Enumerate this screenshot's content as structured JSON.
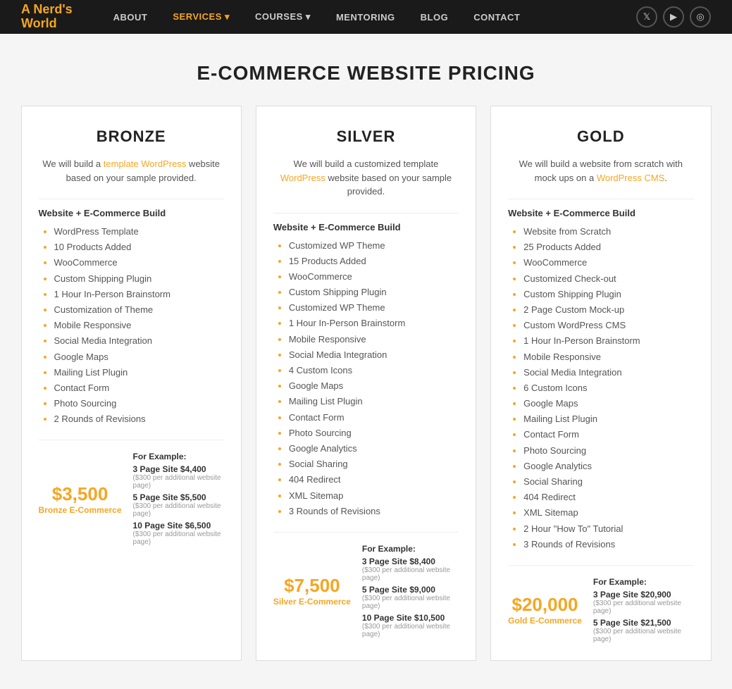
{
  "nav": {
    "logo_line1": "A Nerd's",
    "logo_line2": "World",
    "links": [
      {
        "label": "ABOUT",
        "active": false
      },
      {
        "label": "SERVICES ▾",
        "active": true
      },
      {
        "label": "COURSES ▾",
        "active": false
      },
      {
        "label": "MENTORING",
        "active": false
      },
      {
        "label": "BLOG",
        "active": false
      },
      {
        "label": "CONTACT",
        "active": false
      }
    ],
    "icons": [
      "𝕏",
      "▶",
      "📷"
    ]
  },
  "page": {
    "title": "E-COMMERCE WEBSITE PRICING"
  },
  "cards": [
    {
      "title": "BRONZE",
      "desc_parts": [
        "We will build a ",
        "template WordPress",
        " website based on your sample provided."
      ],
      "desc_link_index": 1,
      "section_label": "Website + E-Commerce Build",
      "features": [
        "WordPress Template",
        "10 Products Added",
        "WooCommerce",
        "Custom Shipping Plugin",
        "1 Hour In-Person Brainstorm",
        "Customization of Theme",
        "Mobile Responsive",
        "Social Media Integration",
        "Google Maps",
        "Mailing List Plugin",
        "Contact Form",
        "Photo Sourcing",
        "2 Rounds of Revisions"
      ],
      "price_main": "$3,500",
      "price_label": "Bronze E-Commerce",
      "for_example": "For Example:",
      "tiers": [
        {
          "label": "3 Page Site $4,400",
          "note": "($300 per additional website page)"
        },
        {
          "label": "5 Page Site $5,500",
          "note": "($300 per additional website page)"
        },
        {
          "label": "10 Page Site $6,500",
          "note": "($300 per additional website page)"
        }
      ]
    },
    {
      "title": "SILVER",
      "desc_parts": [
        "We will build a customized template ",
        "WordPress",
        " website based on your sample provided."
      ],
      "desc_link_index": 1,
      "section_label": "Website + E-Commerce Build",
      "features": [
        "Customized WP Theme",
        "15 Products Added",
        "WooCommerce",
        "Custom Shipping Plugin",
        "Customized WP Theme",
        "1 Hour In-Person Brainstorm",
        "Mobile Responsive",
        "Social Media Integration",
        "4 Custom Icons",
        "Google Maps",
        "Mailing List Plugin",
        "Contact Form",
        "Photo Sourcing",
        "Google Analytics",
        "Social Sharing",
        "404 Redirect",
        "XML Sitemap",
        "3 Rounds of Revisions"
      ],
      "price_main": "$7,500",
      "price_label": "Silver E-Commerce",
      "for_example": "For Example:",
      "tiers": [
        {
          "label": "3 Page Site $8,400",
          "note": "($300 per additional website page)"
        },
        {
          "label": "5 Page Site $9,000",
          "note": "($300 per additional website page)"
        },
        {
          "label": "10 Page Site $10,500",
          "note": "($300 per additional website page)"
        }
      ]
    },
    {
      "title": "GOLD",
      "desc_parts": [
        "We will build a website from scratch with mock ups on a ",
        "WordPress CMS",
        "."
      ],
      "desc_link_index": 1,
      "section_label": "Website + E-Commerce Build",
      "features": [
        "Website from Scratch",
        "25 Products Added",
        "WooCommerce",
        "Customized Check-out",
        "Custom Shipping Plugin",
        "2 Page Custom Mock-up",
        "Custom WordPress CMS",
        "1 Hour In-Person Brainstorm",
        "Mobile Responsive",
        "Social Media Integration",
        "6 Custom Icons",
        "Google Maps",
        "Mailing List Plugin",
        "Contact Form",
        "Photo Sourcing",
        "Google Analytics",
        "Social Sharing",
        "404 Redirect",
        "XML Sitemap",
        "2 Hour \"How To\" Tutorial",
        "3 Rounds of Revisions"
      ],
      "price_main": "$20,000",
      "price_label": "Gold E-Commerce",
      "for_example": "For Example:",
      "tiers": [
        {
          "label": "3 Page Site $20,900",
          "note": "($300 per additional website page)"
        },
        {
          "label": "5 Page Site $21,500",
          "note": "($300 per additional website page)"
        }
      ]
    }
  ]
}
